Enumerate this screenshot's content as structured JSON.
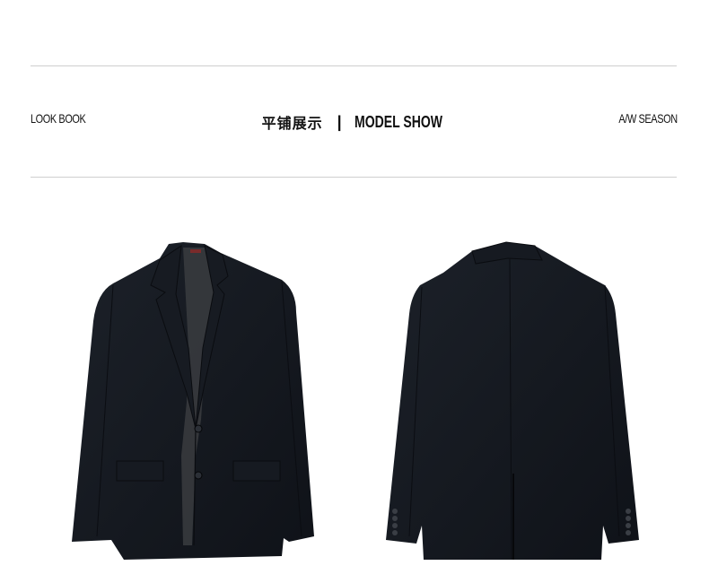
{
  "header": {
    "left_label": "LOOK BOOK",
    "title_cn": "平铺展示",
    "separator": "|",
    "title_en": "MODEL SHOW",
    "right_label": "A/W SEASON"
  },
  "images": {
    "front": "blazer-front",
    "back": "blazer-back"
  },
  "colors": {
    "jacket": "#14181f",
    "lining": "#3a3a3a",
    "rule": "#cfcfcf"
  }
}
